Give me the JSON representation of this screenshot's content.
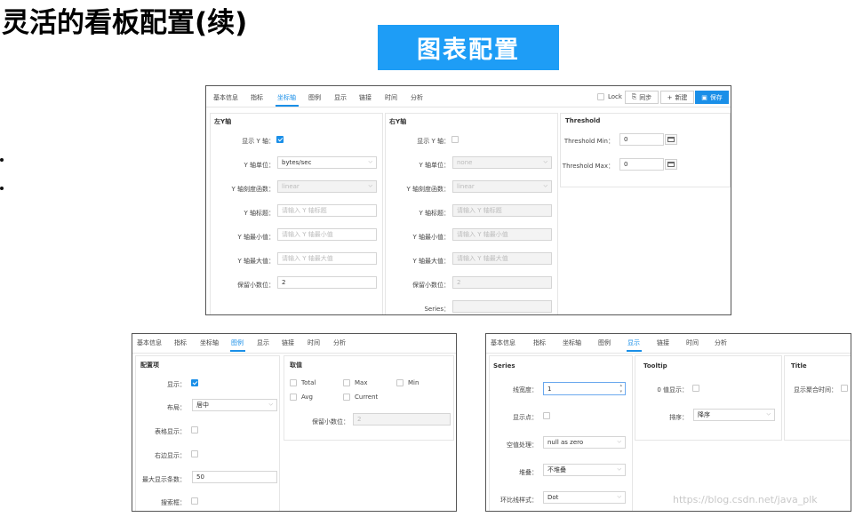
{
  "slide": {
    "title": "灵活的看板配置(续)",
    "banner": "图表配置",
    "watermark": "https://blog.csdn.net/java_plk"
  },
  "tabs": [
    "基本信息",
    "指标",
    "坐标轴",
    "图例",
    "显示",
    "链接",
    "时间",
    "分析"
  ],
  "main": {
    "active_tab": "坐标轴",
    "toolbar": {
      "lock": "Lock",
      "sync": "同步",
      "new": "新建",
      "save": "保存"
    },
    "left_y": {
      "title": "左Y轴",
      "show_label": "显示 Y 轴：",
      "show_checked": true,
      "unit_label": "Y 轴单位：",
      "unit_value": "bytes/sec",
      "scale_label": "Y 轴刻度函数：",
      "scale_value": "linear",
      "title_label": "Y 轴标题：",
      "title_placeholder": "请输入 Y 轴标题",
      "min_label": "Y 轴最小值：",
      "min_placeholder": "请输入 Y 轴最小值",
      "max_label": "Y 轴最大值：",
      "max_placeholder": "请输入 Y 轴最大值",
      "decimals_label": "保留小数位：",
      "decimals_value": "2"
    },
    "right_y": {
      "title": "右Y轴",
      "show_label": "显示 Y 轴：",
      "show_checked": false,
      "unit_label": "Y 轴单位：",
      "unit_value": "none",
      "scale_label": "Y 轴刻度函数：",
      "scale_value": "linear",
      "title_label": "Y 轴标题：",
      "title_placeholder": "请输入 Y 轴标题",
      "min_label": "Y 轴最小值：",
      "min_placeholder": "请输入 Y 轴最小值",
      "max_label": "Y 轴最大值：",
      "max_placeholder": "请输入 Y 轴最大值",
      "decimals_label": "保留小数位：",
      "decimals_value": "2",
      "series_label": "Series："
    },
    "threshold": {
      "title": "Threshold",
      "min_label": "Threshold Min：",
      "min_value": "0",
      "max_label": "Threshold Max：",
      "max_value": "0"
    }
  },
  "legend": {
    "active_tab": "图例",
    "config": {
      "title": "配置项",
      "show_label": "显示：",
      "show_checked": true,
      "layout_label": "布局：",
      "layout_value": "居中",
      "table_label": "表格显示：",
      "right_label": "右边显示：",
      "max_label": "最大显示条数：",
      "max_value": "50",
      "search_label": "搜索框："
    },
    "values": {
      "title": "取值",
      "total": "Total",
      "max": "Max",
      "min": "Min",
      "avg": "Avg",
      "current": "Current",
      "decimals_label": "保留小数位：",
      "decimals_value": "2"
    }
  },
  "display": {
    "active_tab": "显示",
    "series": {
      "title": "Series",
      "line_width_label": "线宽度：",
      "line_width_value": "1",
      "points_label": "显示点：",
      "null_label": "空值处理：",
      "null_value": "null as zero",
      "stack_label": "堆叠：",
      "stack_value": "不堆叠",
      "ring_label": "环比线样式：",
      "ring_value": "Dot"
    },
    "tooltip": {
      "title": "Tooltip",
      "zero_label": "0 值显示：",
      "sort_label": "排序：",
      "sort_value": "降序"
    },
    "title_sect": {
      "title": "Title",
      "agg_label": "显示聚合时间："
    }
  }
}
